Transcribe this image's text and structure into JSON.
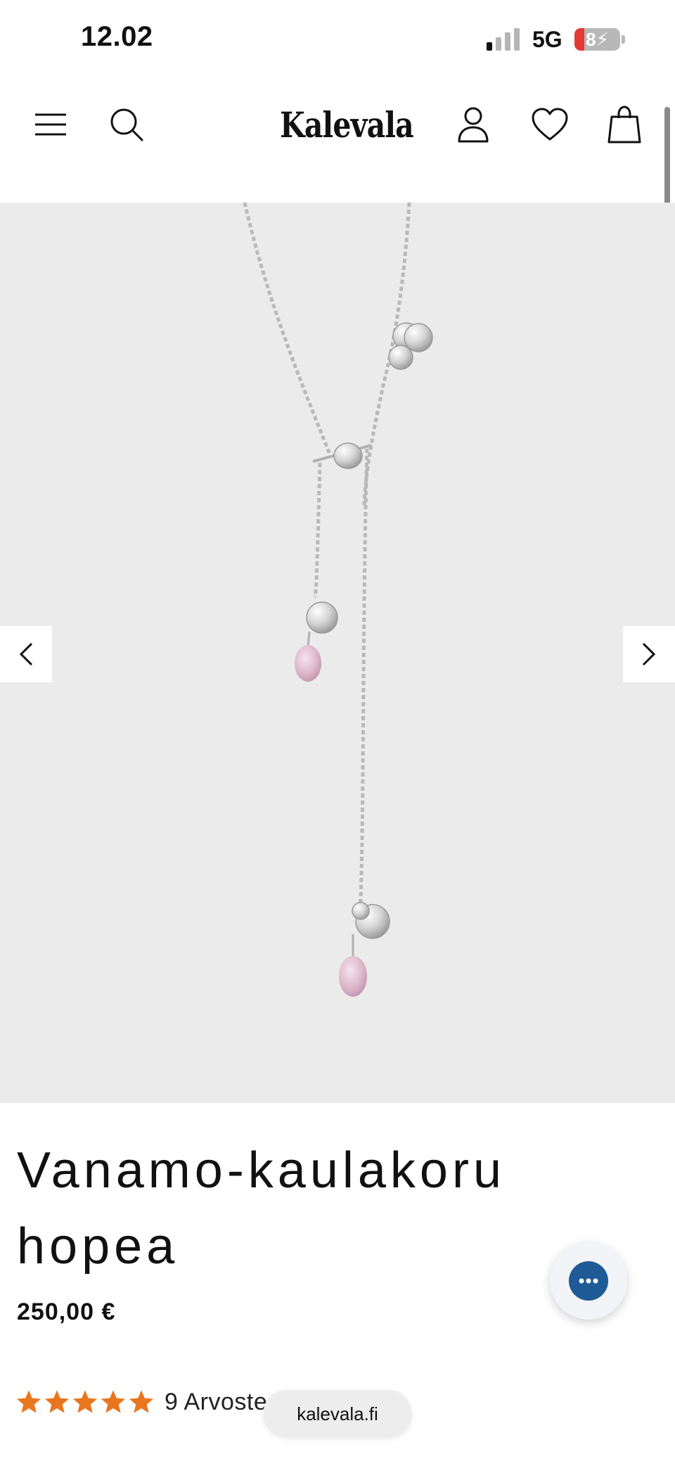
{
  "status_bar": {
    "time": "12.02",
    "network": "5G",
    "battery": "8"
  },
  "header": {
    "logo": "Kalevala"
  },
  "product": {
    "title_line1": "Vanamo-kaulakoru",
    "title_line2": "hopea",
    "price": "250,00 €",
    "rating_stars": 5,
    "review_text": "9 Arvoste"
  },
  "browser": {
    "url": "kalevala.fi"
  },
  "colors": {
    "star": "#e8761f",
    "chat": "#1e5a96",
    "gallery_bg": "#ebebeb"
  },
  "icons": [
    "menu-icon",
    "search-icon",
    "user-icon",
    "heart-icon",
    "bag-icon",
    "chevron-left-icon",
    "chevron-right-icon",
    "star-icon",
    "chat-icon"
  ]
}
